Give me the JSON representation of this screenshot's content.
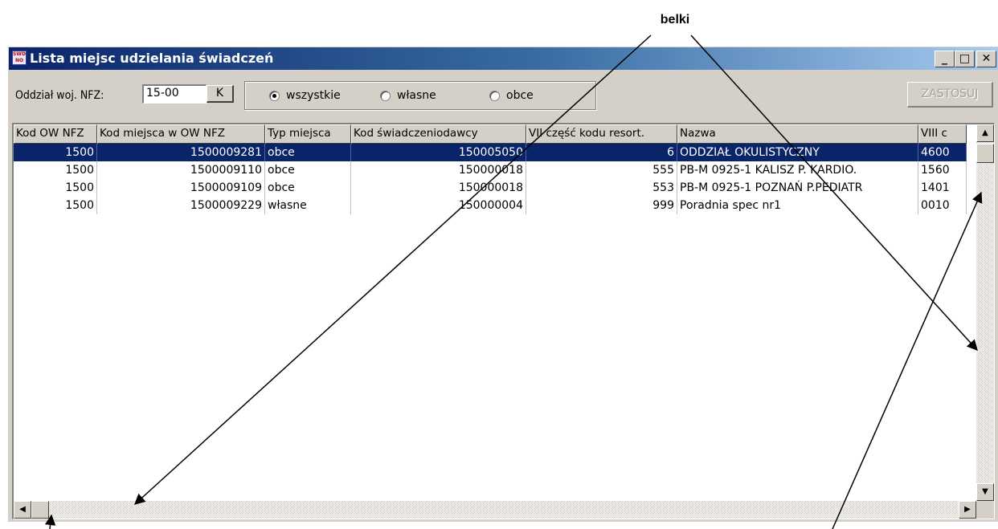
{
  "annotation": {
    "label": "belki"
  },
  "window": {
    "title": "Lista miejsc udzielania świadczeń",
    "app_icon_text": "SWD NO",
    "minimize": "_",
    "maximize": "□",
    "close": "✕"
  },
  "filters": {
    "oddzial_label": "Oddział woj. NFZ:",
    "oddzial_value": "15-00",
    "k_button": "K",
    "radios": [
      {
        "label": "wszystkie",
        "checked": true
      },
      {
        "label": "własne",
        "checked": false
      },
      {
        "label": "obce",
        "checked": false
      }
    ],
    "apply": "ZASTOSUJ"
  },
  "table": {
    "columns": [
      "Kod OW NFZ",
      "Kod miejsca w OW NFZ",
      "Typ miejsca",
      "Kod świadczeniodawcy",
      "VII część kodu resort.",
      "Nazwa",
      "VIII c"
    ],
    "rows": [
      [
        "1500",
        "1500009281",
        "obce",
        "150005050",
        "6",
        "ODDZIAŁ OKULISTYCZNY",
        "4600"
      ],
      [
        "1500",
        "1500009110",
        "obce",
        "150000018",
        "555",
        "PB-M 0925-1 KALISZ P. KARDIO.",
        "1560"
      ],
      [
        "1500",
        "1500009109",
        "obce",
        "150000018",
        "553",
        "PB-M 0925-1 POZNAŃ P.PEDIATR",
        "1401"
      ],
      [
        "1500",
        "1500009229",
        "własne",
        "150000004",
        "999",
        "Poradnia spec nr1",
        "0010"
      ]
    ],
    "selected_row": 0
  },
  "scrollbars": {
    "up": "▲",
    "down": "▼",
    "left": "◀",
    "right": "▶"
  }
}
